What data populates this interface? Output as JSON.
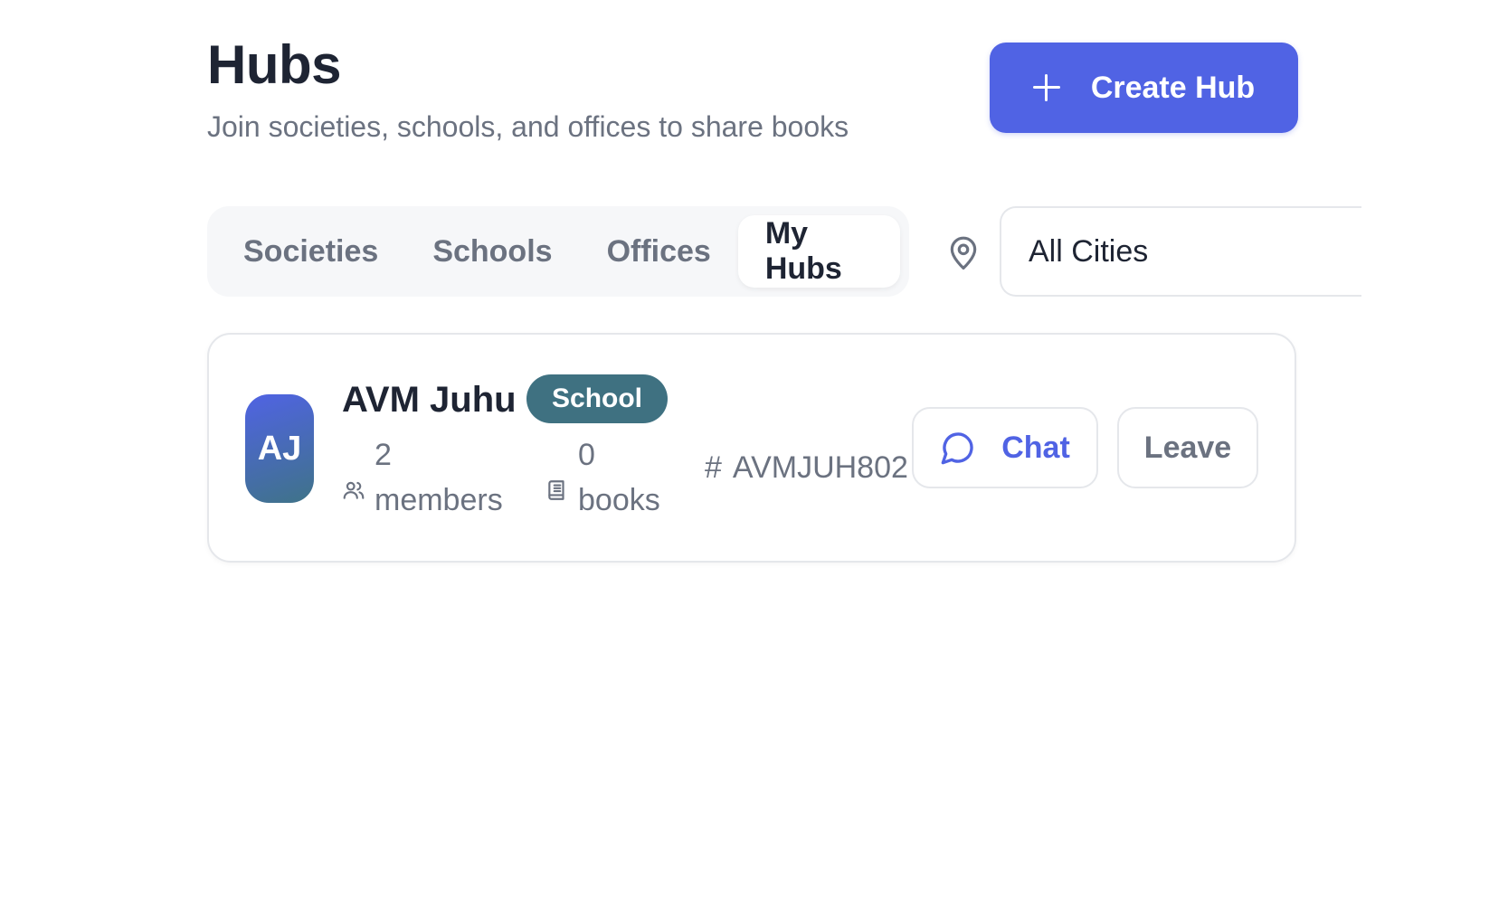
{
  "header": {
    "title": "Hubs",
    "subtitle": "Join societies, schools, and offices to share books"
  },
  "actions": {
    "create_label": "Create Hub",
    "create_icon": "plus-icon"
  },
  "tabs": [
    {
      "label": "Societies",
      "active": false
    },
    {
      "label": "Schools",
      "active": false
    },
    {
      "label": "Offices",
      "active": false
    },
    {
      "label": "My Hubs",
      "active": true
    }
  ],
  "filter": {
    "location_icon": "map-pin-icon",
    "city_value": "All Cities"
  },
  "hubs": [
    {
      "initials": "AJ",
      "name": "AVM Juhu",
      "type": "School",
      "members_count": "2",
      "members_label": "members",
      "books_count": "0",
      "books_label": "books",
      "code_symbol": "#",
      "code": "AVMJUH802",
      "chat_label": "Chat",
      "leave_label": "Leave"
    }
  ],
  "colors": {
    "primary": "#5063e4",
    "badge": "#3f7181",
    "muted_text": "#6b7280",
    "heading_text": "#1e2433"
  }
}
